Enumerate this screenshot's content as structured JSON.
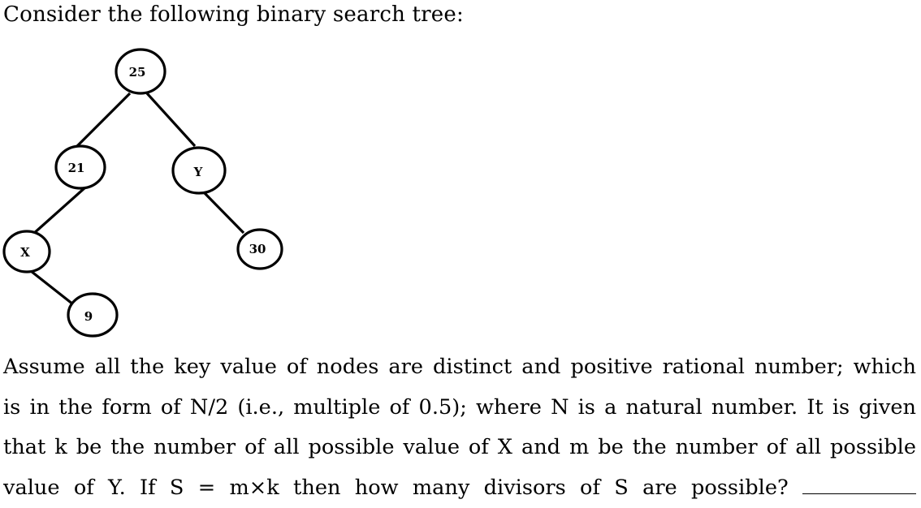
{
  "intro": "Consider the following binary search tree:",
  "tree": {
    "nodes": [
      {
        "id": "n25",
        "label": "25"
      },
      {
        "id": "n21",
        "label": "21"
      },
      {
        "id": "nY",
        "label": "Y"
      },
      {
        "id": "nX",
        "label": "X"
      },
      {
        "id": "n30",
        "label": "30"
      },
      {
        "id": "n9",
        "label": "9"
      }
    ]
  },
  "question": {
    "line1": "Assume all the key value of nodes are distinct and positive rational number; which",
    "line2": "is in the form of N/2 (i.e., multiple of 0.5); where N is a natural number. It is given",
    "line3": "that k be the number of all possible value of X and m be the number of all possible",
    "line4": "value of Y. If S = m×k then how many divisors of S are possible?"
  }
}
